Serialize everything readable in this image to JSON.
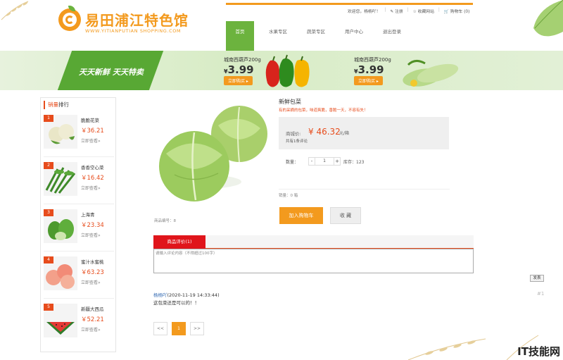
{
  "brand": {
    "name": "易田浦江特色馆",
    "subtitle": "WWW.YITIANPUTIAN SHOPPING.COM",
    "color": "#f39a1e"
  },
  "topbar": {
    "welcome": "欢迎您，",
    "username": "杨杨吖！",
    "register": "注册",
    "favorite_site": "收藏网站",
    "cart": "购物车",
    "cart_count": "(0)"
  },
  "nav": {
    "items": [
      {
        "label": "首页",
        "active": true
      },
      {
        "label": "水果专区",
        "active": false
      },
      {
        "label": "蔬菜专区",
        "active": false
      },
      {
        "label": "用户中心",
        "active": false
      },
      {
        "label": "退出登录",
        "active": false
      }
    ]
  },
  "banner": {
    "slogan": "天天新鲜 天天特卖",
    "promos": [
      {
        "title": "城南西葫芦200g",
        "currency": "¥",
        "price": "3.99",
        "button": "立即购买"
      },
      {
        "title": "城南西葫芦200g",
        "currency": "¥",
        "price": "3.99",
        "button": "立即购买"
      }
    ]
  },
  "sidebar": {
    "title_hot": "销量",
    "title_rest": "排行",
    "items": [
      {
        "rank": "1",
        "name": "脆脆花菜",
        "price": "￥36.21",
        "link": "立即查看»"
      },
      {
        "rank": "2",
        "name": "香香空心菜",
        "price": "￥16.42",
        "link": "立即查看»"
      },
      {
        "rank": "3",
        "name": "上海青",
        "price": "￥23.34",
        "link": "立即查看»"
      },
      {
        "rank": "4",
        "name": "蜜汁水蜜桃",
        "price": "￥63.23",
        "link": "立即查看»"
      },
      {
        "rank": "5",
        "name": "新疆大西瓜",
        "price": "￥52.21",
        "link": "立即查看»"
      }
    ]
  },
  "product": {
    "name": "新鲜包菜",
    "slogan": "有的采摘的包菜，味道爽脆，香脆一天，不容有失！",
    "price_label": "商城价:",
    "price": "¥ 46.32",
    "unit": "元/箱",
    "review_count": "共有1条评论",
    "qty_label": "数量：",
    "qty_minus": "-",
    "qty_value": "1",
    "qty_plus": "+",
    "stock": "库存：123",
    "sales": "销量：0  箱",
    "image_counter": "商品编号：8",
    "add_to_cart": "加入购物车",
    "favorite": "收 藏"
  },
  "reviews": {
    "tab_label": "商品评价(1)",
    "input_placeholder": "请输入评论内容（不得超过100字）",
    "send": "发表",
    "comments": [
      {
        "user": "杨杨吖",
        "time": "(2020-11-19 14:33:44)",
        "text": "这包菜还是可以的！！",
        "floor": "#1"
      }
    ]
  },
  "pager": {
    "prev": "<<",
    "current": "1",
    "next": ">>"
  },
  "watermark": "IT技能网"
}
